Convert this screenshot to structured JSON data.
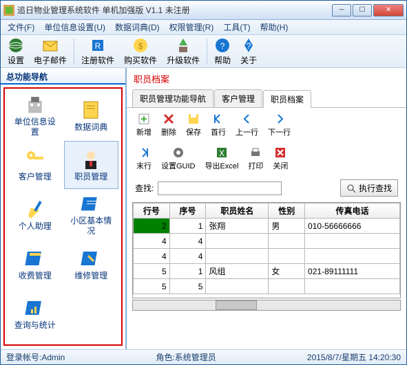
{
  "window": {
    "title": "追日物业管理系统软件 单机加强版 V1.1 未注册"
  },
  "menu": {
    "file": "文件(F)",
    "unit": "单位信息设置(U)",
    "dict": "数据词典(D)",
    "perm": "权限管理(R)",
    "tool": "工具(T)",
    "help": "帮助(H)"
  },
  "toolbar": {
    "settings": "设置",
    "email": "电子邮件",
    "register": "注册软件",
    "buy": "购买软件",
    "upgrade": "升级软件",
    "helpbtn": "帮助",
    "about": "关于"
  },
  "sidebar": {
    "tab": "总功能导航",
    "items": [
      {
        "label": "单位信息设置"
      },
      {
        "label": "数据词典"
      },
      {
        "label": "客户管理"
      },
      {
        "label": "职员管理"
      },
      {
        "label": "个人助理"
      },
      {
        "label": "小区基本情况"
      },
      {
        "label": "收费管理"
      },
      {
        "label": "维修管理"
      },
      {
        "label": "查询与统计"
      }
    ]
  },
  "main": {
    "title": "职员档案",
    "tabs": [
      {
        "label": "职员管理功能导航"
      },
      {
        "label": "客户管理"
      },
      {
        "label": "职员档案"
      }
    ],
    "mini": {
      "add": "新增",
      "del": "删除",
      "save": "保存",
      "first": "首行",
      "prev": "上一行",
      "next": "下一行",
      "last": "末行",
      "guid": "设置GUID",
      "excel": "导出Excel",
      "print": "打印",
      "close": "关闭"
    },
    "search": {
      "label": "查找:",
      "value": "",
      "btn": "执行查找"
    },
    "columns": [
      "行号",
      "序号",
      "职员姓名",
      "性别",
      "传真电话"
    ],
    "rows": [
      {
        "rownum": "2",
        "seq": "1",
        "name": "张翔",
        "gender": "男",
        "fax": "010-56666666"
      },
      {
        "rownum": "4",
        "seq": "4",
        "name": "",
        "gender": "",
        "fax": ""
      },
      {
        "rownum": "4",
        "seq": "4",
        "name": "",
        "gender": "",
        "fax": ""
      },
      {
        "rownum": "5",
        "seq": "1",
        "name": "风组",
        "gender": "女",
        "fax": "021-89111111"
      },
      {
        "rownum": "5",
        "seq": "5",
        "name": "",
        "gender": "",
        "fax": ""
      }
    ]
  },
  "status": {
    "account_label": "登录帐号:",
    "account": "Admin",
    "role_label": "角色:",
    "role": "系统管理员",
    "datetime": "2015/8/7/星期五 14:20:30"
  }
}
